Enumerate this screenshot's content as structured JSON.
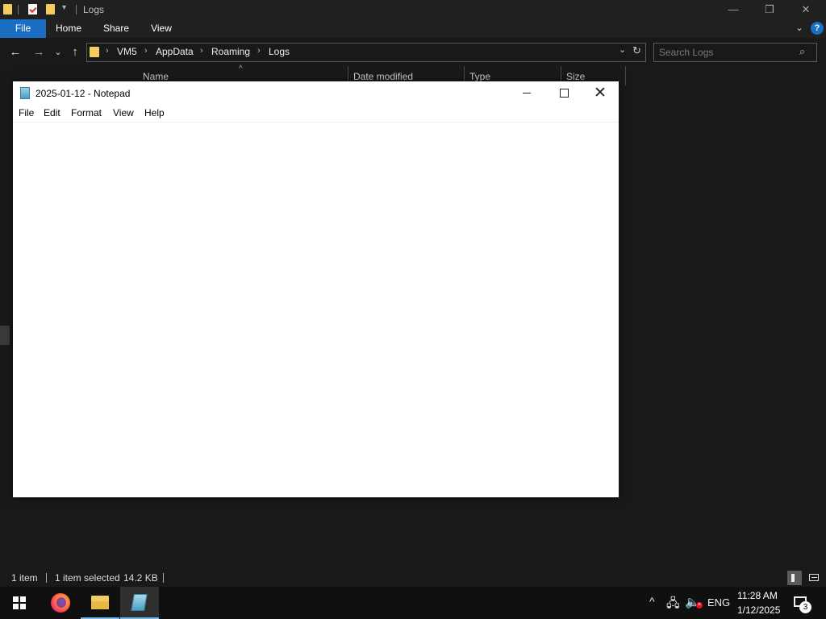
{
  "explorer": {
    "title": "Logs",
    "titlebar_controls": {
      "minimize": "—",
      "restore": "❐",
      "close": "✕"
    },
    "ribbon_tabs": [
      "File",
      "Home",
      "Share",
      "View"
    ],
    "ribbon_expand": "⌄",
    "help": "?",
    "nav": {
      "back": "←",
      "forward": "→",
      "recent": "⌄",
      "up": "↑"
    },
    "breadcrumb": [
      "VM5",
      "AppData",
      "Roaming",
      "Logs"
    ],
    "breadcrumb_sep": "›",
    "address_dropdown": "⌄",
    "refresh": "↻",
    "search_placeholder": "Search Logs",
    "search_icon": "⌕",
    "columns": [
      "Name",
      "Date modified",
      "Type",
      "Size"
    ],
    "sort_arrow": "^",
    "status": {
      "item_count": "1 item",
      "selected": "1 item selected",
      "size": "14.2 KB"
    }
  },
  "notepad": {
    "title": "2025-01-12 - Notepad",
    "menu": [
      "File",
      "Edit",
      "Format",
      "View",
      "Help"
    ],
    "content": "",
    "close_glyph": "✕"
  },
  "taskbar": {
    "tray_chevron": "^",
    "language": "ENG",
    "time": "11:28 AM",
    "date": "1/12/2025",
    "notification_count": "3",
    "network_glyph": "🖧",
    "volume_glyph": "🔈",
    "volume_muted": "×"
  },
  "colors": {
    "accent": "#1b6ec2",
    "folder": "#f3cd62",
    "dark_bg": "#191919",
    "taskbar_bg": "#101010"
  }
}
